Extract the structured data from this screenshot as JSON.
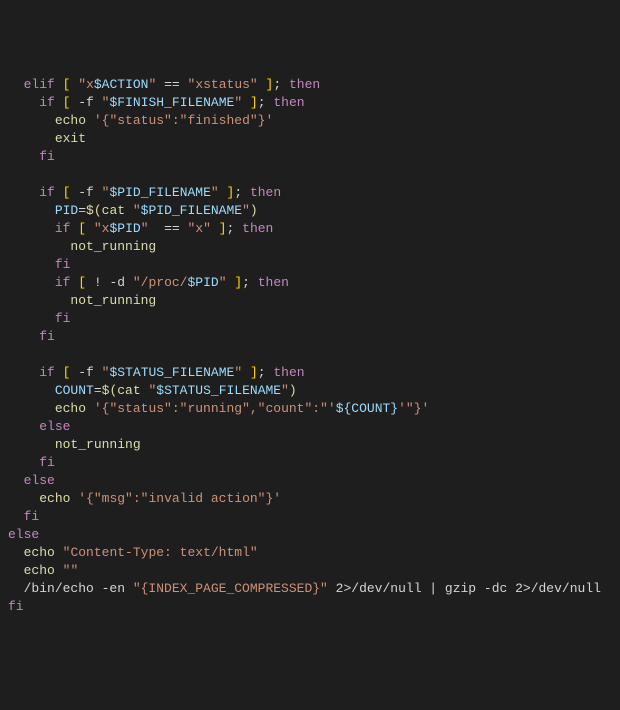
{
  "lines": [
    {
      "indent": 0,
      "segs": [
        {
          "c": "kw",
          "t": "elif"
        },
        {
          "c": "op",
          "t": " "
        },
        {
          "c": "br",
          "t": "["
        },
        {
          "c": "op",
          "t": " "
        },
        {
          "c": "str",
          "t": "\"x"
        },
        {
          "c": "var",
          "t": "$ACTION"
        },
        {
          "c": "str",
          "t": "\""
        },
        {
          "c": "op",
          "t": " == "
        },
        {
          "c": "str",
          "t": "\"xstatus\""
        },
        {
          "c": "op",
          "t": " "
        },
        {
          "c": "br",
          "t": "]"
        },
        {
          "c": "op",
          "t": "; "
        },
        {
          "c": "kw",
          "t": "then"
        }
      ]
    },
    {
      "indent": 1,
      "segs": [
        {
          "c": "kw",
          "t": "if"
        },
        {
          "c": "op",
          "t": " "
        },
        {
          "c": "br",
          "t": "["
        },
        {
          "c": "op",
          "t": " -f "
        },
        {
          "c": "str",
          "t": "\""
        },
        {
          "c": "var",
          "t": "$FINISH_FILENAME"
        },
        {
          "c": "str",
          "t": "\""
        },
        {
          "c": "op",
          "t": " "
        },
        {
          "c": "br",
          "t": "]"
        },
        {
          "c": "op",
          "t": "; "
        },
        {
          "c": "kw",
          "t": "then"
        }
      ]
    },
    {
      "indent": 2,
      "segs": [
        {
          "c": "cmd",
          "t": "echo"
        },
        {
          "c": "op",
          "t": " "
        },
        {
          "c": "str",
          "t": "'{\"status\":\"finished\"}'"
        }
      ]
    },
    {
      "indent": 2,
      "segs": [
        {
          "c": "cmd",
          "t": "exit"
        }
      ]
    },
    {
      "indent": 1,
      "segs": [
        {
          "c": "kw",
          "t": "fi"
        }
      ]
    },
    {
      "indent": 0,
      "segs": [
        {
          "c": "op",
          "t": ""
        }
      ]
    },
    {
      "indent": 1,
      "segs": [
        {
          "c": "kw",
          "t": "if"
        },
        {
          "c": "op",
          "t": " "
        },
        {
          "c": "br",
          "t": "["
        },
        {
          "c": "op",
          "t": " -f "
        },
        {
          "c": "str",
          "t": "\""
        },
        {
          "c": "var",
          "t": "$PID_FILENAME"
        },
        {
          "c": "str",
          "t": "\""
        },
        {
          "c": "op",
          "t": " "
        },
        {
          "c": "br",
          "t": "]"
        },
        {
          "c": "op",
          "t": "; "
        },
        {
          "c": "kw",
          "t": "then"
        }
      ]
    },
    {
      "indent": 2,
      "segs": [
        {
          "c": "var",
          "t": "PID"
        },
        {
          "c": "op",
          "t": "="
        },
        {
          "c": "fn",
          "t": "$("
        },
        {
          "c": "cmd",
          "t": "cat"
        },
        {
          "c": "op",
          "t": " "
        },
        {
          "c": "str",
          "t": "\""
        },
        {
          "c": "var",
          "t": "$PID_FILENAME"
        },
        {
          "c": "str",
          "t": "\""
        },
        {
          "c": "fn",
          "t": ")"
        }
      ]
    },
    {
      "indent": 2,
      "segs": [
        {
          "c": "kw",
          "t": "if"
        },
        {
          "c": "op",
          "t": " "
        },
        {
          "c": "br",
          "t": "["
        },
        {
          "c": "op",
          "t": " "
        },
        {
          "c": "str",
          "t": "\"x"
        },
        {
          "c": "var",
          "t": "$PID"
        },
        {
          "c": "str",
          "t": "\""
        },
        {
          "c": "op",
          "t": "  == "
        },
        {
          "c": "str",
          "t": "\"x\""
        },
        {
          "c": "op",
          "t": " "
        },
        {
          "c": "br",
          "t": "]"
        },
        {
          "c": "op",
          "t": "; "
        },
        {
          "c": "kw",
          "t": "then"
        }
      ]
    },
    {
      "indent": 3,
      "segs": [
        {
          "c": "fn",
          "t": "not_running"
        }
      ]
    },
    {
      "indent": 2,
      "segs": [
        {
          "c": "kw",
          "t": "fi"
        }
      ]
    },
    {
      "indent": 2,
      "segs": [
        {
          "c": "kw",
          "t": "if"
        },
        {
          "c": "op",
          "t": " "
        },
        {
          "c": "br",
          "t": "["
        },
        {
          "c": "op",
          "t": " ! -d "
        },
        {
          "c": "str",
          "t": "\"/proc/"
        },
        {
          "c": "var",
          "t": "$PID"
        },
        {
          "c": "str",
          "t": "\""
        },
        {
          "c": "op",
          "t": " "
        },
        {
          "c": "br",
          "t": "]"
        },
        {
          "c": "op",
          "t": "; "
        },
        {
          "c": "kw",
          "t": "then"
        }
      ]
    },
    {
      "indent": 3,
      "segs": [
        {
          "c": "fn",
          "t": "not_running"
        }
      ]
    },
    {
      "indent": 2,
      "segs": [
        {
          "c": "kw",
          "t": "fi"
        }
      ]
    },
    {
      "indent": 1,
      "segs": [
        {
          "c": "kw",
          "t": "fi"
        }
      ]
    },
    {
      "indent": 0,
      "segs": [
        {
          "c": "op",
          "t": ""
        }
      ]
    },
    {
      "indent": 1,
      "segs": [
        {
          "c": "kw",
          "t": "if"
        },
        {
          "c": "op",
          "t": " "
        },
        {
          "c": "br",
          "t": "["
        },
        {
          "c": "op",
          "t": " -f "
        },
        {
          "c": "str",
          "t": "\""
        },
        {
          "c": "var",
          "t": "$STATUS_FILENAME"
        },
        {
          "c": "str",
          "t": "\""
        },
        {
          "c": "op",
          "t": " "
        },
        {
          "c": "br",
          "t": "]"
        },
        {
          "c": "op",
          "t": "; "
        },
        {
          "c": "kw",
          "t": "then"
        }
      ]
    },
    {
      "indent": 2,
      "segs": [
        {
          "c": "var",
          "t": "COUNT"
        },
        {
          "c": "op",
          "t": "="
        },
        {
          "c": "fn",
          "t": "$("
        },
        {
          "c": "cmd",
          "t": "cat"
        },
        {
          "c": "op",
          "t": " "
        },
        {
          "c": "str",
          "t": "\""
        },
        {
          "c": "var",
          "t": "$STATUS_FILENAME"
        },
        {
          "c": "str",
          "t": "\""
        },
        {
          "c": "fn",
          "t": ")"
        }
      ]
    },
    {
      "indent": 2,
      "segs": [
        {
          "c": "cmd",
          "t": "echo"
        },
        {
          "c": "op",
          "t": " "
        },
        {
          "c": "str",
          "t": "'{\"status\":\"running\",\"count\":\"'"
        },
        {
          "c": "var",
          "t": "${COUNT}"
        },
        {
          "c": "str",
          "t": "'\"}'"
        }
      ]
    },
    {
      "indent": 1,
      "segs": [
        {
          "c": "kw",
          "t": "else"
        }
      ]
    },
    {
      "indent": 2,
      "segs": [
        {
          "c": "fn",
          "t": "not_running"
        }
      ]
    },
    {
      "indent": 1,
      "segs": [
        {
          "c": "kw",
          "t": "fi"
        }
      ]
    },
    {
      "indent": 0,
      "segs": [
        {
          "c": "kw",
          "t": "else"
        }
      ]
    },
    {
      "indent": 1,
      "segs": [
        {
          "c": "cmd",
          "t": "echo"
        },
        {
          "c": "op",
          "t": " "
        },
        {
          "c": "str",
          "t": "'{\"msg\":\"invalid action\"}'"
        }
      ]
    },
    {
      "indent": 0,
      "segs": [
        {
          "c": "kw",
          "t": "fi"
        }
      ]
    },
    {
      "indent": -1,
      "segs": [
        {
          "c": "kw",
          "t": "else"
        }
      ]
    },
    {
      "indent": 0,
      "segs": [
        {
          "c": "cmd",
          "t": "echo"
        },
        {
          "c": "op",
          "t": " "
        },
        {
          "c": "str",
          "t": "\"Content-Type: text/html\""
        }
      ]
    },
    {
      "indent": 0,
      "segs": [
        {
          "c": "cmd",
          "t": "echo"
        },
        {
          "c": "op",
          "t": " "
        },
        {
          "c": "str",
          "t": "\"\""
        }
      ]
    },
    {
      "indent": 0,
      "segs": [
        {
          "c": "op",
          "t": "/bin/echo -en "
        },
        {
          "c": "str",
          "t": "\"{INDEX_PAGE_COMPRESSED}\""
        },
        {
          "c": "op",
          "t": " 2>/dev/null | gzip -dc 2>/dev/null"
        }
      ]
    },
    {
      "indent": -1,
      "segs": [
        {
          "c": "kw",
          "t": "fi"
        }
      ]
    }
  ],
  "baseIndent": "  ",
  "unit": "  "
}
